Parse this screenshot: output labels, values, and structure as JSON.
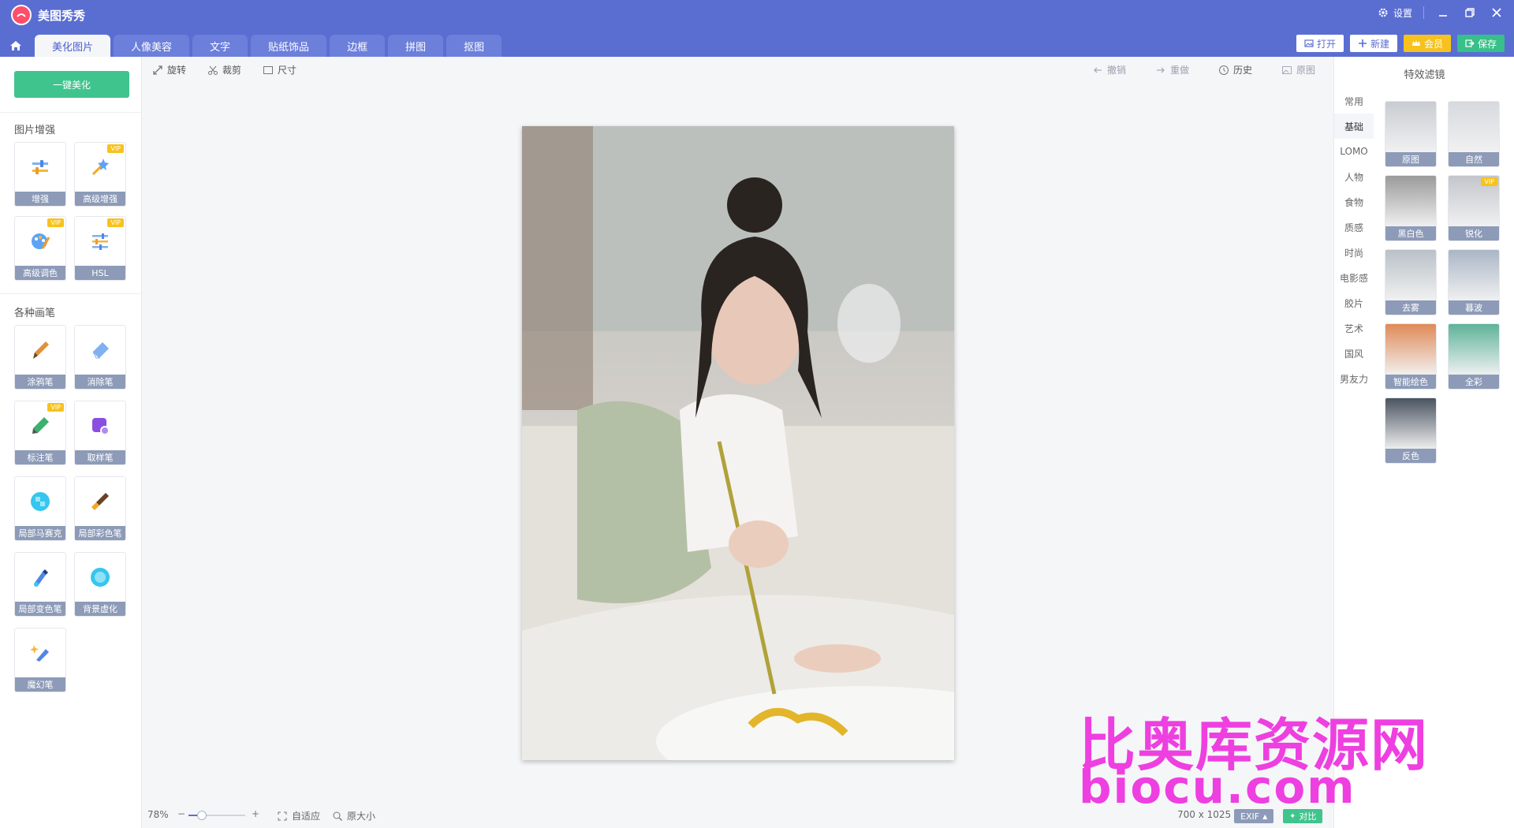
{
  "app": {
    "title": "美图秀秀"
  },
  "window": {
    "settings_label": "设置"
  },
  "tabs": [
    {
      "label": "美化图片",
      "active": true
    },
    {
      "label": "人像美容"
    },
    {
      "label": "文字"
    },
    {
      "label": "贴纸饰品"
    },
    {
      "label": "边框"
    },
    {
      "label": "拼图"
    },
    {
      "label": "抠图"
    }
  ],
  "actions": {
    "open": "打开",
    "new": "新建",
    "vip": "会员",
    "save": "保存"
  },
  "left": {
    "one_click": "一键美化",
    "enhance_title": "图片增强",
    "enhance_tools": [
      {
        "label": "增强",
        "vip": false,
        "icon": "sliders-icon"
      },
      {
        "label": "高级增强",
        "vip": true,
        "icon": "magic-wand-icon"
      },
      {
        "label": "高级调色",
        "vip": true,
        "icon": "palette-icon"
      },
      {
        "label": "HSL",
        "vip": true,
        "icon": "hsl-sliders-icon"
      }
    ],
    "brush_title": "各种画笔",
    "brush_tools": [
      {
        "label": "涂鸦笔",
        "vip": false,
        "icon": "brush-icon"
      },
      {
        "label": "消除笔",
        "vip": false,
        "icon": "eraser-icon"
      },
      {
        "label": "标注笔",
        "vip": true,
        "icon": "marker-icon"
      },
      {
        "label": "取样笔",
        "vip": false,
        "icon": "sample-pen-icon"
      },
      {
        "label": "局部马赛克",
        "vip": false,
        "icon": "mosaic-icon"
      },
      {
        "label": "局部彩色笔",
        "vip": false,
        "icon": "color-brush-icon"
      },
      {
        "label": "局部变色笔",
        "vip": false,
        "icon": "recolor-pen-icon"
      },
      {
        "label": "背景虚化",
        "vip": false,
        "icon": "blur-icon"
      },
      {
        "label": "魔幻笔",
        "vip": false,
        "icon": "magic-pen-icon"
      }
    ],
    "vip_tag": "VIP"
  },
  "toolbar": {
    "rotate": "旋转",
    "crop": "裁剪",
    "size": "尺寸",
    "undo": "撤销",
    "redo": "重做",
    "history": "历史",
    "original": "原图"
  },
  "status": {
    "zoom": "78%",
    "zoom_level": 0.24,
    "fit": "自适应",
    "actual": "原大小",
    "dimensions": "700 x 1025",
    "exif": "EXIF",
    "compare": "对比"
  },
  "filters": {
    "title": "特效滤镜",
    "categories": [
      {
        "label": "常用"
      },
      {
        "label": "基础",
        "active": true
      },
      {
        "label": "LOMO"
      },
      {
        "label": "人物"
      },
      {
        "label": "食物"
      },
      {
        "label": "质感"
      },
      {
        "label": "时尚"
      },
      {
        "label": "电影感"
      },
      {
        "label": "胶片"
      },
      {
        "label": "艺术"
      },
      {
        "label": "国风"
      },
      {
        "label": "男友力"
      }
    ],
    "items": [
      {
        "label": "原图",
        "tone": "#c8ccd2",
        "vip": false
      },
      {
        "label": "自然",
        "tone": "#d6d9de",
        "vip": false
      },
      {
        "label": "黑白色",
        "tone": "#9a9a9a",
        "vip": false
      },
      {
        "label": "锐化",
        "tone": "#c2c6cc",
        "vip": true
      },
      {
        "label": "去雾",
        "tone": "#b9c1c8",
        "vip": false
      },
      {
        "label": "暮波",
        "tone": "#aab6c6",
        "vip": false
      },
      {
        "label": "智能绘色",
        "tone": "#e08a58",
        "vip": false
      },
      {
        "label": "全彩",
        "tone": "#5fb39a",
        "vip": false
      },
      {
        "label": "反色",
        "tone": "#4a5360",
        "vip": false
      }
    ]
  },
  "watermark": {
    "line1": "比奥库资源网",
    "line2": "biocu.com"
  }
}
